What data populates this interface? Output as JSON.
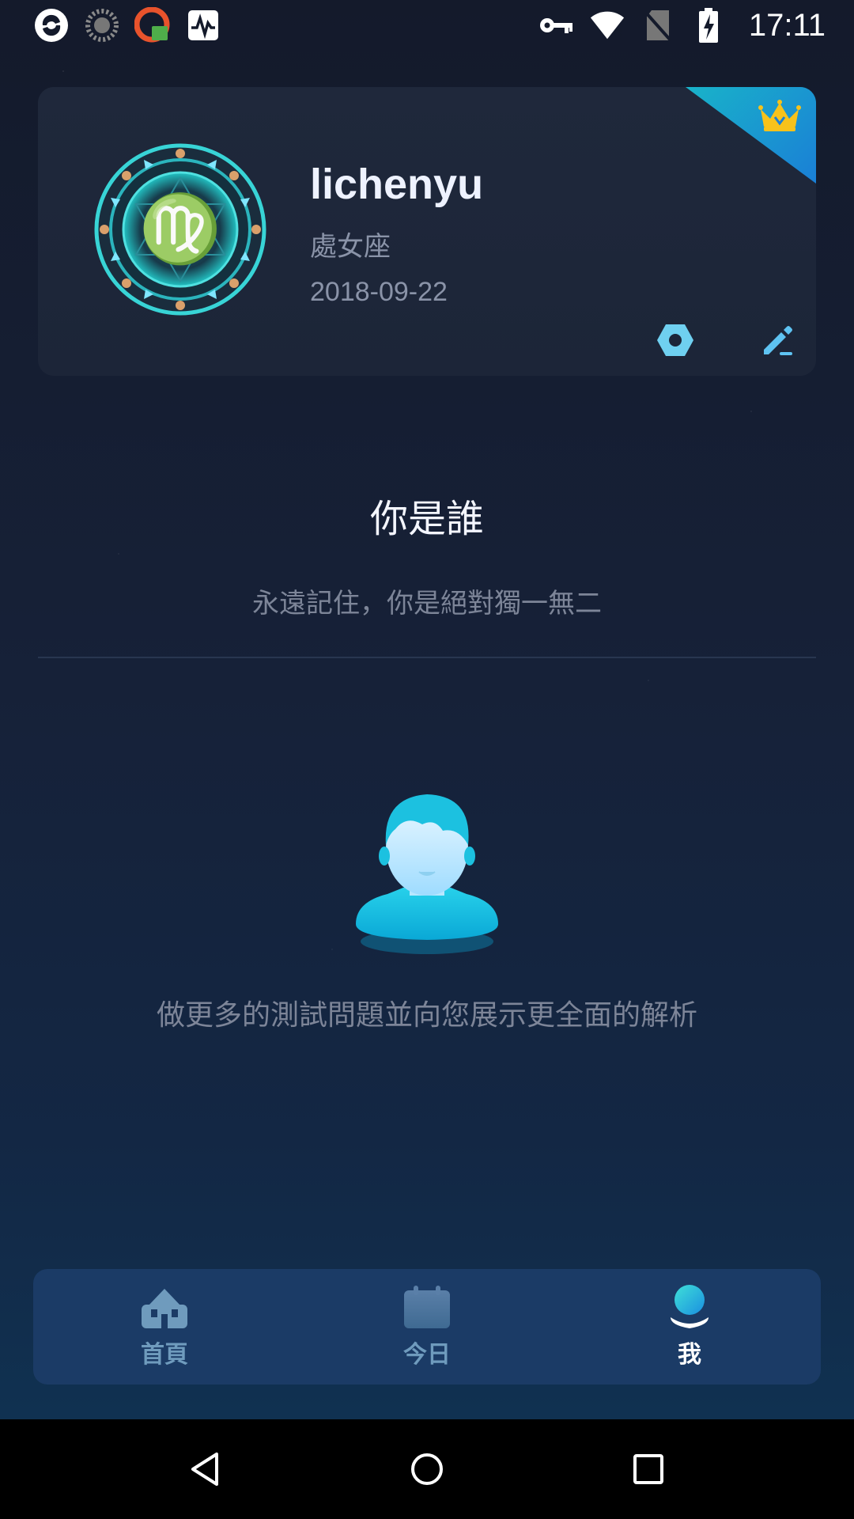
{
  "status_bar": {
    "time": "17:11",
    "left_icons": [
      "app-circle-icon",
      "loading-spinner-icon",
      "vpn-app-icon",
      "activity-monitor-icon"
    ],
    "right_icons": [
      "key-icon",
      "wifi-icon",
      "no-sim-icon",
      "battery-charging-icon"
    ]
  },
  "profile": {
    "name": "lichenyu",
    "zodiac": "處女座",
    "birth_date": "2018-09-22",
    "vip_badge_icon": "crown-icon",
    "accent_color": "#1aa6d6"
  },
  "who": {
    "title": "你是誰",
    "subtitle": "永遠記住，你是絕對獨一無二"
  },
  "prompt": {
    "text": "做更多的測試問題並向您展示更全面的解析"
  },
  "bottom_nav": {
    "items": [
      {
        "label": "首頁",
        "icon": "home-icon",
        "active": false
      },
      {
        "label": "今日",
        "icon": "calendar-icon",
        "active": false
      },
      {
        "label": "我",
        "icon": "profile-icon",
        "active": true
      }
    ]
  },
  "system_nav": [
    "back-icon",
    "home-circle-icon",
    "recents-icon"
  ]
}
